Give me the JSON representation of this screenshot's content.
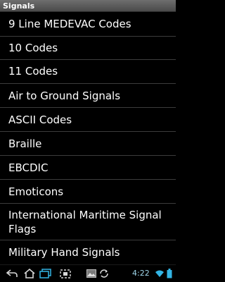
{
  "header": {
    "title": "Signals"
  },
  "list": {
    "items": [
      "9 Line MEDEVAC Codes",
      "10 Codes",
      "11 Codes",
      "Air to Ground Signals",
      "ASCII Codes",
      "Braille",
      "EBCDIC",
      "Emoticons",
      "International Maritime Signal Flags",
      "Military Hand Signals"
    ]
  },
  "system_bar": {
    "icons": [
      "back-icon",
      "home-icon",
      "recent-apps-icon",
      "screenshot-icon",
      "image-notification-icon",
      "sync-icon",
      "wifi-icon",
      "battery-icon"
    ],
    "time": "4:22"
  },
  "colors": {
    "background": "#000000",
    "title_bar": "#5a5a5a",
    "text": "#ffffff",
    "divider": "#3c3c3c",
    "status_text": "#9fd6ea"
  }
}
